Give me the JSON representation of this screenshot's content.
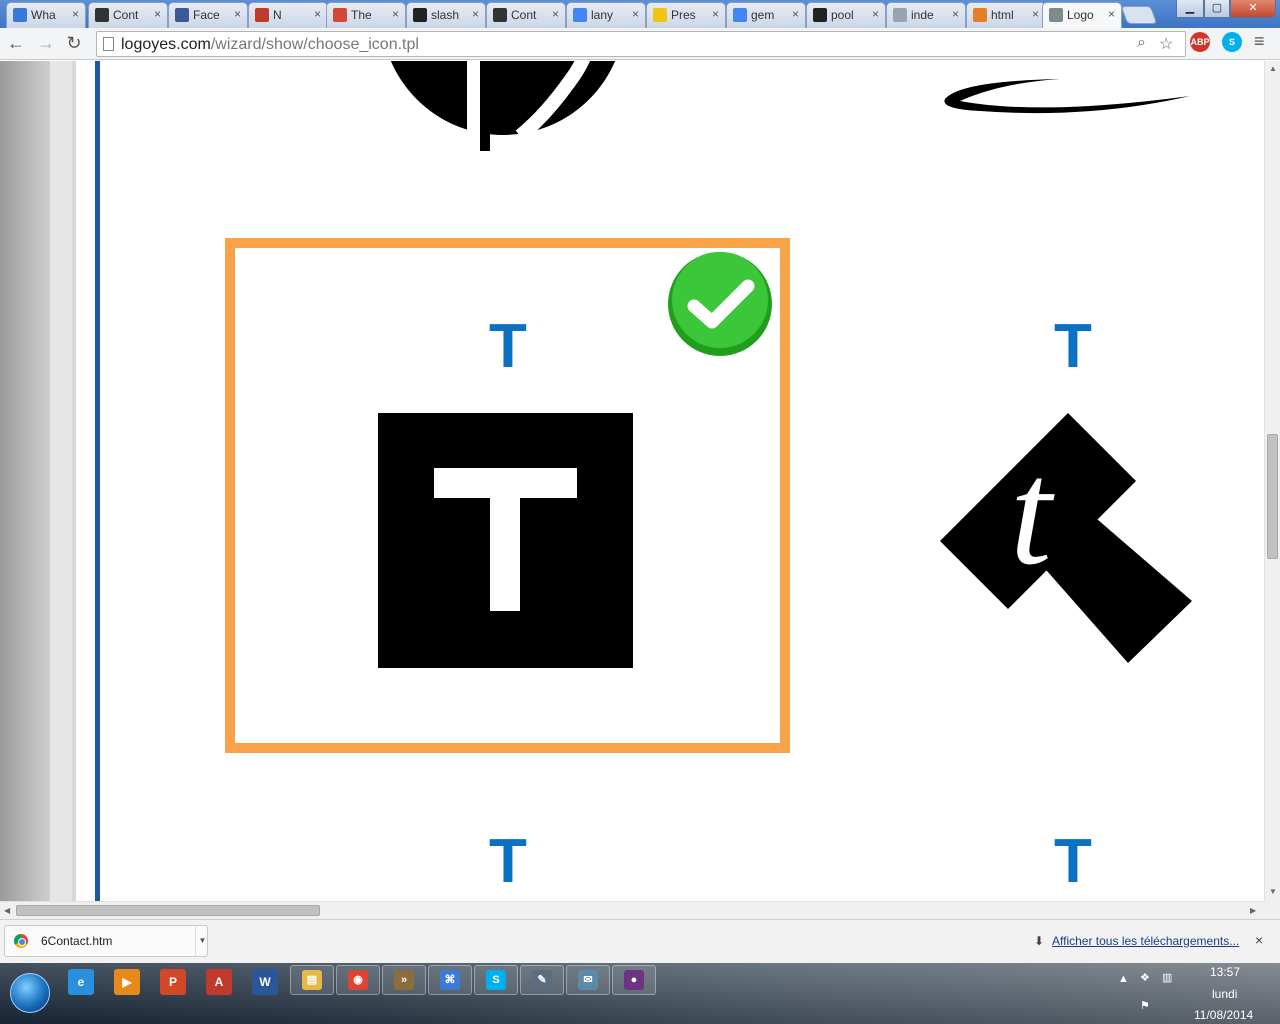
{
  "browser": {
    "tabs": [
      {
        "label": "Wha",
        "favicon": "compass-icon",
        "color": "#3b78d8"
      },
      {
        "label": "Cont",
        "favicon": "l-logo-icon",
        "color": "#333333"
      },
      {
        "label": "Face",
        "favicon": "facebook-icon",
        "color": "#3b5998"
      },
      {
        "label": "N",
        "favicon": "fm-logo-icon",
        "color": "#c0392b"
      },
      {
        "label": "The",
        "favicon": "gmail-icon",
        "color": "#d14836"
      },
      {
        "label": "slash",
        "favicon": "github-icon",
        "color": "#222222"
      },
      {
        "label": "Cont",
        "favicon": "l-logo-icon",
        "color": "#333333"
      },
      {
        "label": "lany",
        "favicon": "google-icon",
        "color": "#4285f4"
      },
      {
        "label": "Pres",
        "favicon": "bulb-icon",
        "color": "#f1c40f"
      },
      {
        "label": "gem",
        "favicon": "google-icon",
        "color": "#4285f4"
      },
      {
        "label": "pool",
        "favicon": "github-icon",
        "color": "#222222"
      },
      {
        "label": "inde",
        "favicon": "page-icon",
        "color": "#9aa4b0"
      },
      {
        "label": "html",
        "favicon": "stack-icon",
        "color": "#e67e22"
      },
      {
        "label": "Logo",
        "favicon": "globe-icon",
        "color": "#7f8c8d",
        "active": true
      }
    ],
    "tab_close_glyph": "×",
    "url_host": "logoyes.com",
    "url_path": "/wizard/show/choose_icon.tpl",
    "extensions": [
      {
        "name": "adblock-plus-icon",
        "label": "ABP",
        "color": "#d0352b",
        "badge": "2"
      },
      {
        "name": "skype-icon",
        "label": "S",
        "color": "#00aff0"
      }
    ]
  },
  "page": {
    "icons": [
      {
        "name": "letter-t-top-left",
        "letter": "T"
      },
      {
        "name": "letter-t-top-right",
        "letter": "T"
      },
      {
        "name": "letter-t-bottom-left",
        "letter": "T"
      },
      {
        "name": "letter-t-bottom-right",
        "letter": "T"
      }
    ],
    "selected_icon_letter": "T",
    "alt_icon_letter": "t",
    "accent_color": "#f9a24a",
    "letter_color": "#0a72c0",
    "check_color": "#2db82b"
  },
  "downloads": {
    "file_name": "6Contact.htm",
    "show_all_label": "Afficher tous les téléchargements...",
    "close_glyph": "×"
  },
  "taskbar": {
    "pinned": [
      {
        "name": "internet-explorer-icon",
        "label": "e",
        "color": "#2a8fdc"
      },
      {
        "name": "media-player-icon",
        "label": "▶",
        "color": "#e88a1a"
      },
      {
        "name": "powerpoint-icon",
        "label": "P",
        "color": "#d24726"
      },
      {
        "name": "pdf-icon",
        "label": "A",
        "color": "#c0392b"
      },
      {
        "name": "word-icon",
        "label": "W",
        "color": "#2b579a"
      }
    ],
    "running": [
      {
        "name": "explorer-icon",
        "label": "▤",
        "color": "#e6b84a"
      },
      {
        "name": "chrome-icon",
        "label": "◉",
        "color": "#db4437"
      },
      {
        "name": "terminal-icon",
        "label": "»",
        "color": "#8a6d3b"
      },
      {
        "name": "remote-desktop-icon",
        "label": "⌘",
        "color": "#3a7bd5"
      },
      {
        "name": "skype-icon",
        "label": "S",
        "color": "#00aff0"
      },
      {
        "name": "paint-icon",
        "label": "✎",
        "color": "#5d6d7e"
      },
      {
        "name": "mail-icon",
        "label": "✉",
        "color": "#5d8aa8"
      },
      {
        "name": "record-icon",
        "label": "●",
        "color": "#6c3483"
      }
    ],
    "time": "13:57",
    "day": "lundi",
    "date": "11/08/2014"
  }
}
